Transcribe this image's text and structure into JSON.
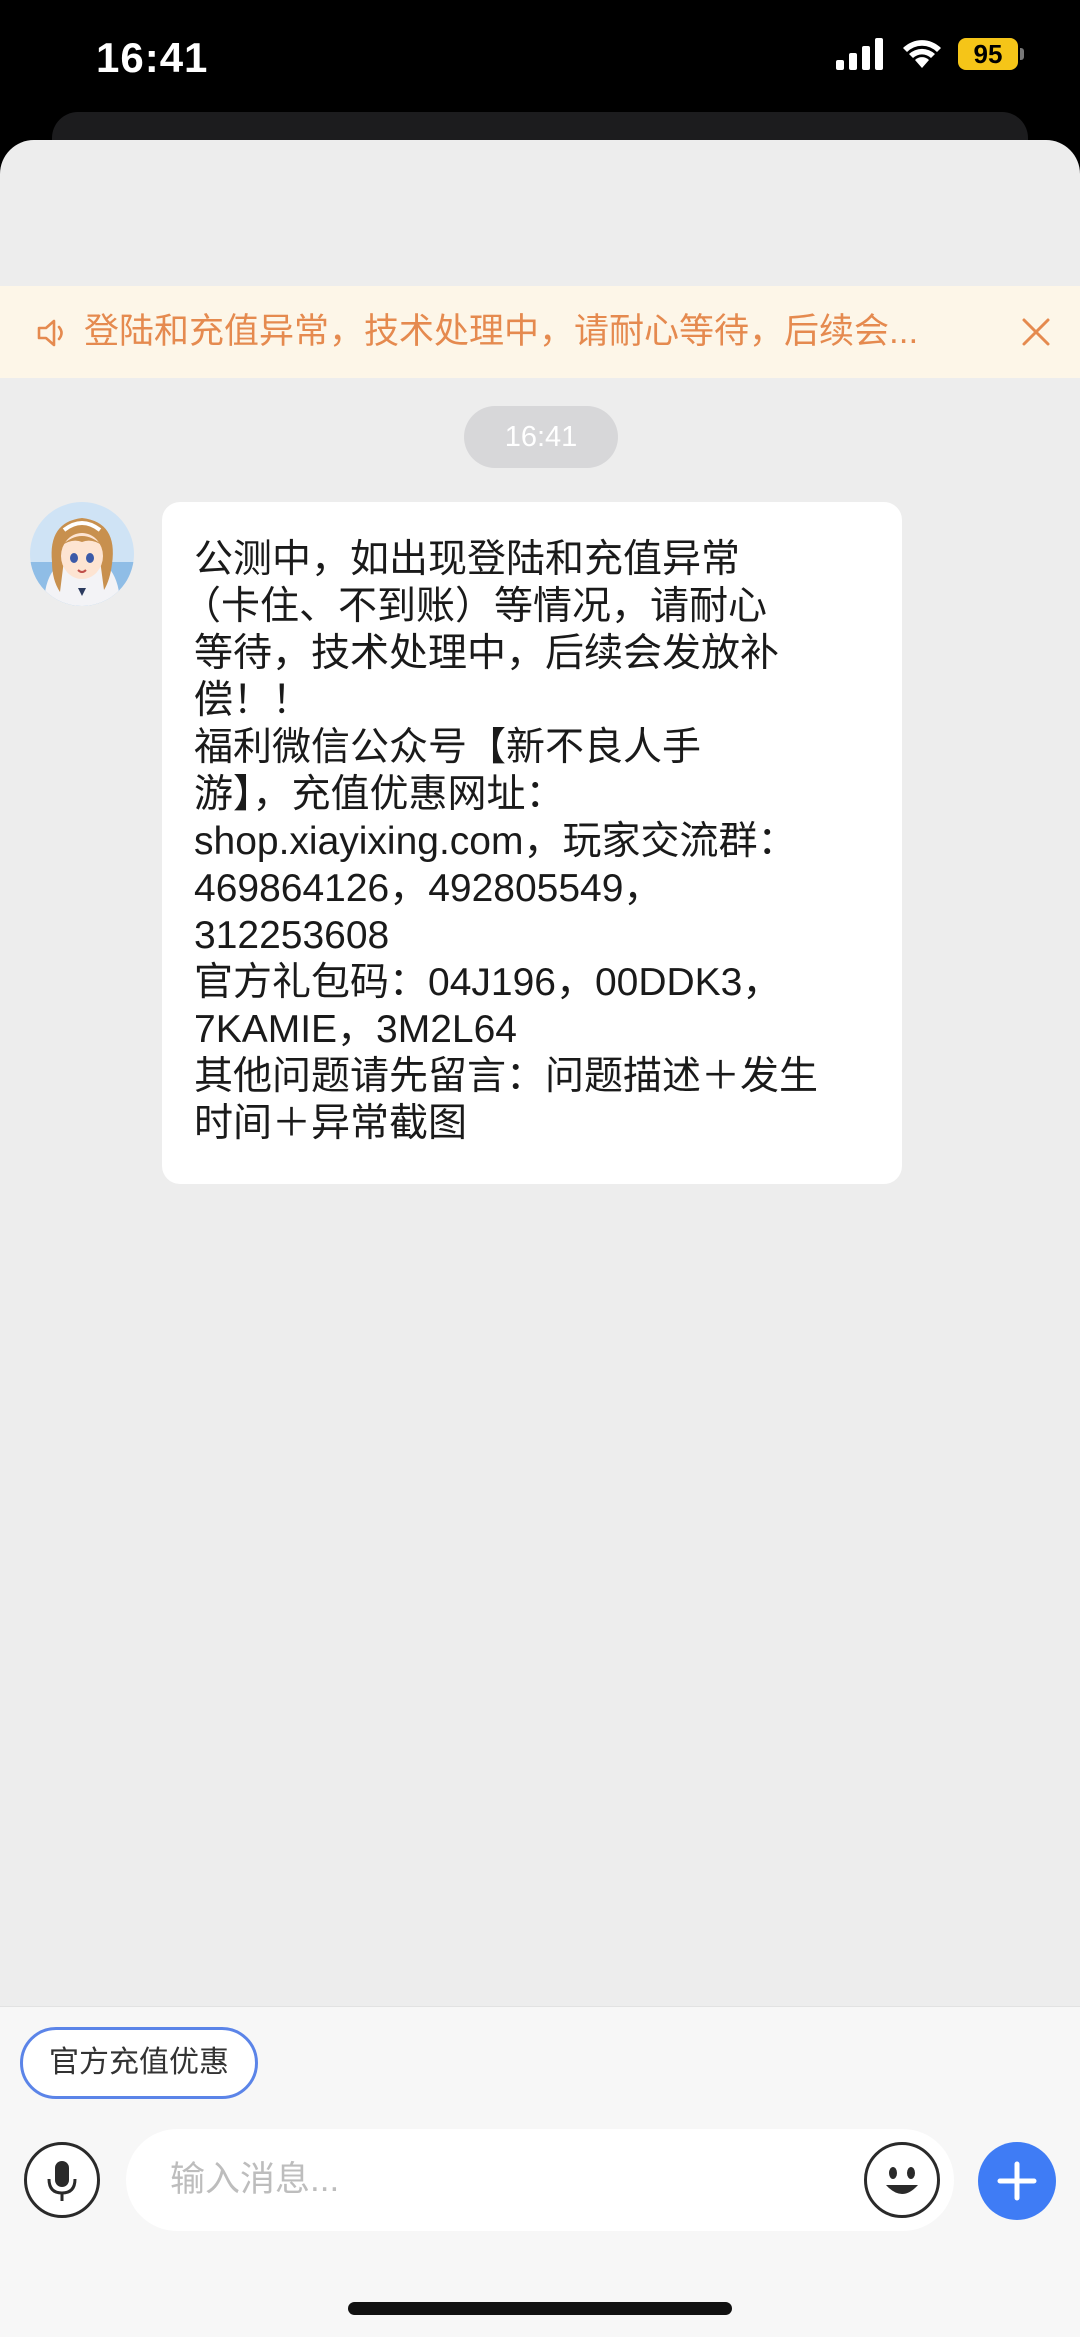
{
  "status_bar": {
    "time": "16:41",
    "battery_level": "95",
    "icons": [
      "cellular-signal-icon",
      "wifi-icon",
      "battery-icon"
    ]
  },
  "notice": {
    "text": "登陆和充值异常，技术处理中，请耐心等待，后续会...",
    "icon": "speaker-icon",
    "close_icon": "close-icon",
    "text_color": "#e58a4f",
    "background": "#fdf6e8"
  },
  "chat": {
    "timestamp": "16:41",
    "messages": [
      {
        "sender": "agent",
        "avatar_icon": "anime-girl-avatar",
        "lines": [
          "公测中，如出现登陆和充值异常",
          "（卡住、不到账）等情况，请耐心",
          "等待，技术处理中，后续会发放补",
          "偿！！",
          "福利微信公众号【新不良人手",
          "游】，充值优惠网址：",
          "shop.xiayixing.com，玩家交流群：",
          "469864126，492805549，",
          "312253608",
          "官方礼包码：04J196，00DDK3，",
          "7KAMIE，3M2L64",
          "其他问题请先留言：问题描述＋发生",
          "时间＋异常截图"
        ]
      }
    ]
  },
  "composer": {
    "quick_reply": "官方充值优惠",
    "input_placeholder": "输入消息...",
    "accent_color": "#3f7cf5",
    "icons": [
      "microphone-icon",
      "emoji-icon",
      "plus-icon"
    ]
  }
}
